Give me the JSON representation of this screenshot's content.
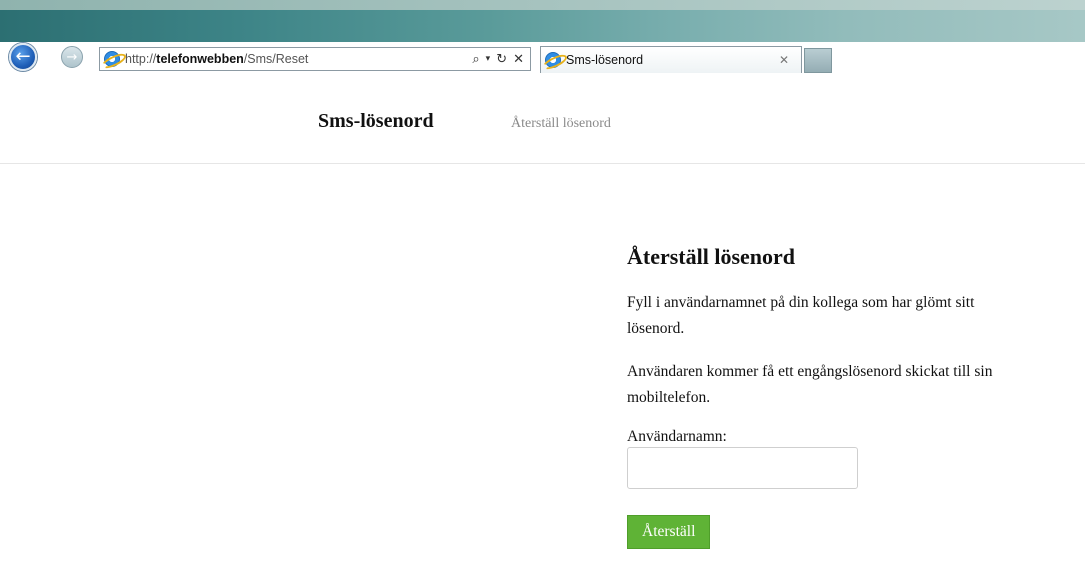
{
  "browser": {
    "url_prefix": "http://",
    "url_host": "telefonwebben",
    "url_path": "/Sms/Reset",
    "tab_title": "Sms-lösenord"
  },
  "navbar": {
    "brand": "Sms-lösenord",
    "link": "Återställ lösenord"
  },
  "main": {
    "title": "Återställ lösenord",
    "paragraph1": "Fyll i användarnamnet på din kollega som har glömt sitt lösenord.",
    "paragraph2": "Användaren kommer få ett engångslösenord skickat till sin mobiltelefon.",
    "username_label": "Användarnamn:",
    "username_value": "",
    "submit_label": "Återställ"
  },
  "colors": {
    "submit_button": "#5fb336",
    "nav_link": "#8a8a8a"
  },
  "icons": [
    "back-icon",
    "forward-icon",
    "ie-icon",
    "search-icon",
    "dropdown-icon",
    "refresh-icon",
    "stop-icon",
    "tab-close-icon"
  ]
}
